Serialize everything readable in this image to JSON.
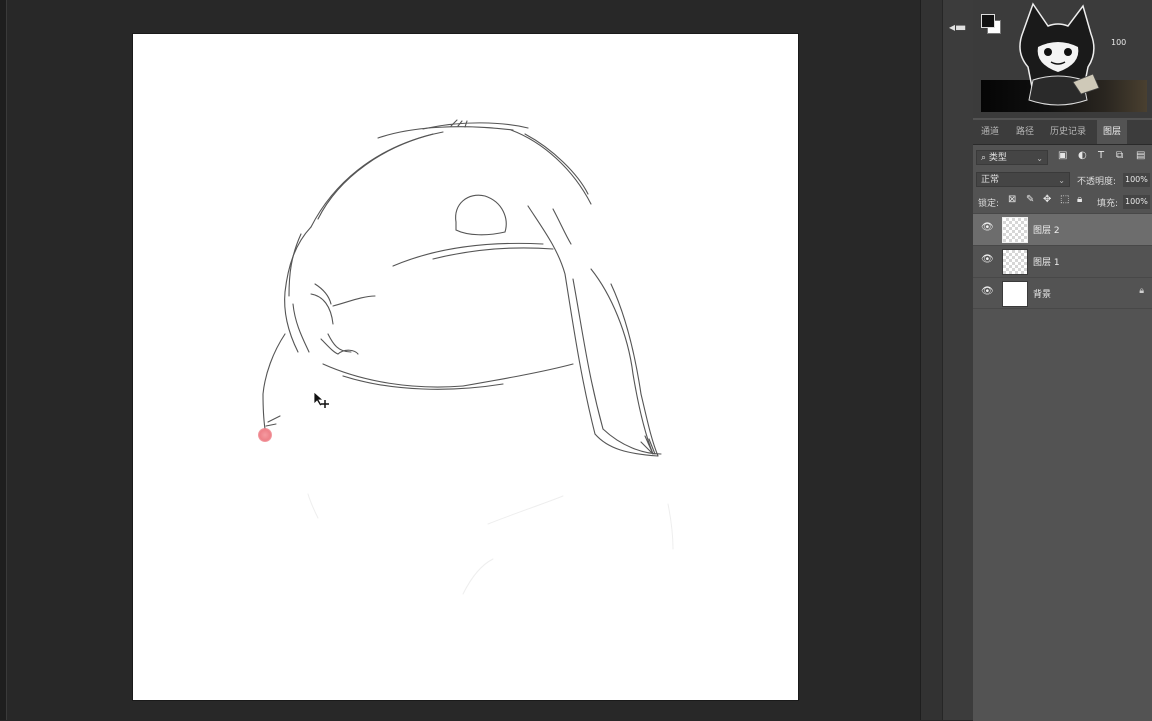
{
  "color_panel": {
    "opacity_small": "100",
    "gradient_colors": [
      "#050505",
      "#2a2620",
      "#4a4030"
    ]
  },
  "tabs": [
    "通道",
    "路径",
    "历史记录",
    "图层"
  ],
  "filter": {
    "kind_label": "类型"
  },
  "blend": {
    "mode": "正常",
    "opacity_label": "不透明度:",
    "opacity_value": "100%"
  },
  "lock": {
    "label": "锁定:",
    "fill_label": "填充:",
    "fill_value": "100%"
  },
  "layers": [
    {
      "name": "图层 2",
      "selected": true
    },
    {
      "name": "图层 1",
      "selected": false
    },
    {
      "name": "背景",
      "selected": false,
      "locked": true
    }
  ],
  "icons": {
    "eye": "eye-icon",
    "lock": "lock-icon",
    "cursor": "move-cursor-icon",
    "dock": "panel-collapse-icon"
  },
  "colors": {
    "workspace": "#282828",
    "panel": "#535353",
    "selected_layer": "#6d6d6d",
    "brush": "#ee8088"
  }
}
